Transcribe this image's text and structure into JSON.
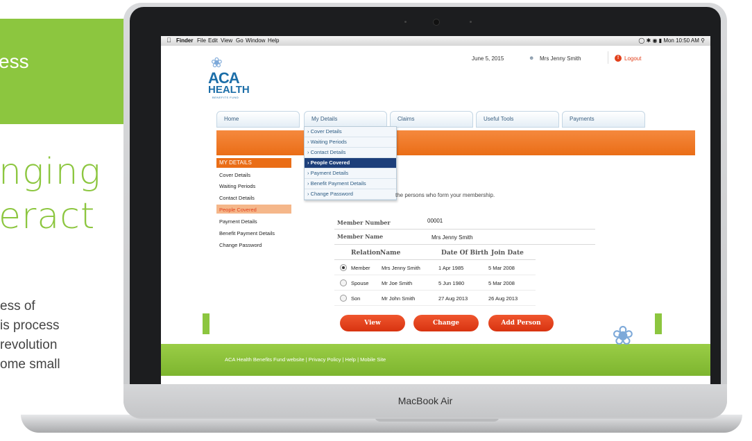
{
  "slide": {
    "heading_fragment": "ess",
    "big_words": [
      "nging",
      "eract"
    ],
    "body_lines": [
      "ess of",
      "is process",
      "revolution",
      "ome small"
    ]
  },
  "laptop": {
    "brand_label": "MacBook Air"
  },
  "mac_menubar": {
    "apple_icon": "apple-icon",
    "items": [
      "Finder",
      "File",
      "Edit",
      "View",
      "Go",
      "Window",
      "Help"
    ],
    "clock": "Mon 10:50 AM"
  },
  "site": {
    "date": "June 5, 2015",
    "user_name": "Mrs Jenny Smith",
    "logout_label": "Logout",
    "logo": {
      "line1": "ACA",
      "line2": "HEALTH",
      "line3": "BENEFITS FUND"
    },
    "nav_tabs": [
      "Home",
      "My Details",
      "Claims",
      "Useful Tools",
      "Payments"
    ],
    "dropdown_items": [
      "› Cover Details",
      "› Waiting Periods",
      "› Contact Details",
      "› People Covered",
      "› Payment Details",
      "› Benefit Payment Details",
      "› Change Password"
    ],
    "dropdown_active_index": 3,
    "sidebar": {
      "heading": "MY DETAILS",
      "items": [
        "Cover Details",
        "Waiting Periods",
        "Contact Details",
        "People Covered",
        "Payment Details",
        "Benefit Payment Details",
        "Change Password"
      ],
      "active_index": 3
    },
    "intro_text": "the persons who form your membership.",
    "member_number_label": "Member Number",
    "member_number_value": "00001",
    "member_name_label": "Member Name",
    "member_name_value": "Mrs Jenny Smith",
    "table": {
      "headers": [
        "Relation",
        "Name",
        "Date Of Birth",
        "Join Date"
      ],
      "rows": [
        {
          "relation": "Member",
          "name": "Mrs Jenny Smith",
          "dob": "1 Apr 1985",
          "join": "5 Mar 2008",
          "selected": true
        },
        {
          "relation": "Spouse",
          "name": "Mr Joe Smith",
          "dob": "5 Jun 1980",
          "join": "5 Mar 2008",
          "selected": false
        },
        {
          "relation": "Son",
          "name": "Mr John Smith",
          "dob": "27 Aug 2013",
          "join": "26 Aug 2013",
          "selected": false
        }
      ]
    },
    "buttons": {
      "view": "View",
      "change": "Change",
      "add_person": "Add Person"
    },
    "footer_text": "ACA Health Benefits Fund website  |  Privacy Policy  |  Help  |  Mobile Site",
    "colors": {
      "brand_green": "#8cc63f",
      "brand_orange": "#ea6d16",
      "brand_blue": "#1c6ea8",
      "button_red": "#e04418"
    }
  }
}
